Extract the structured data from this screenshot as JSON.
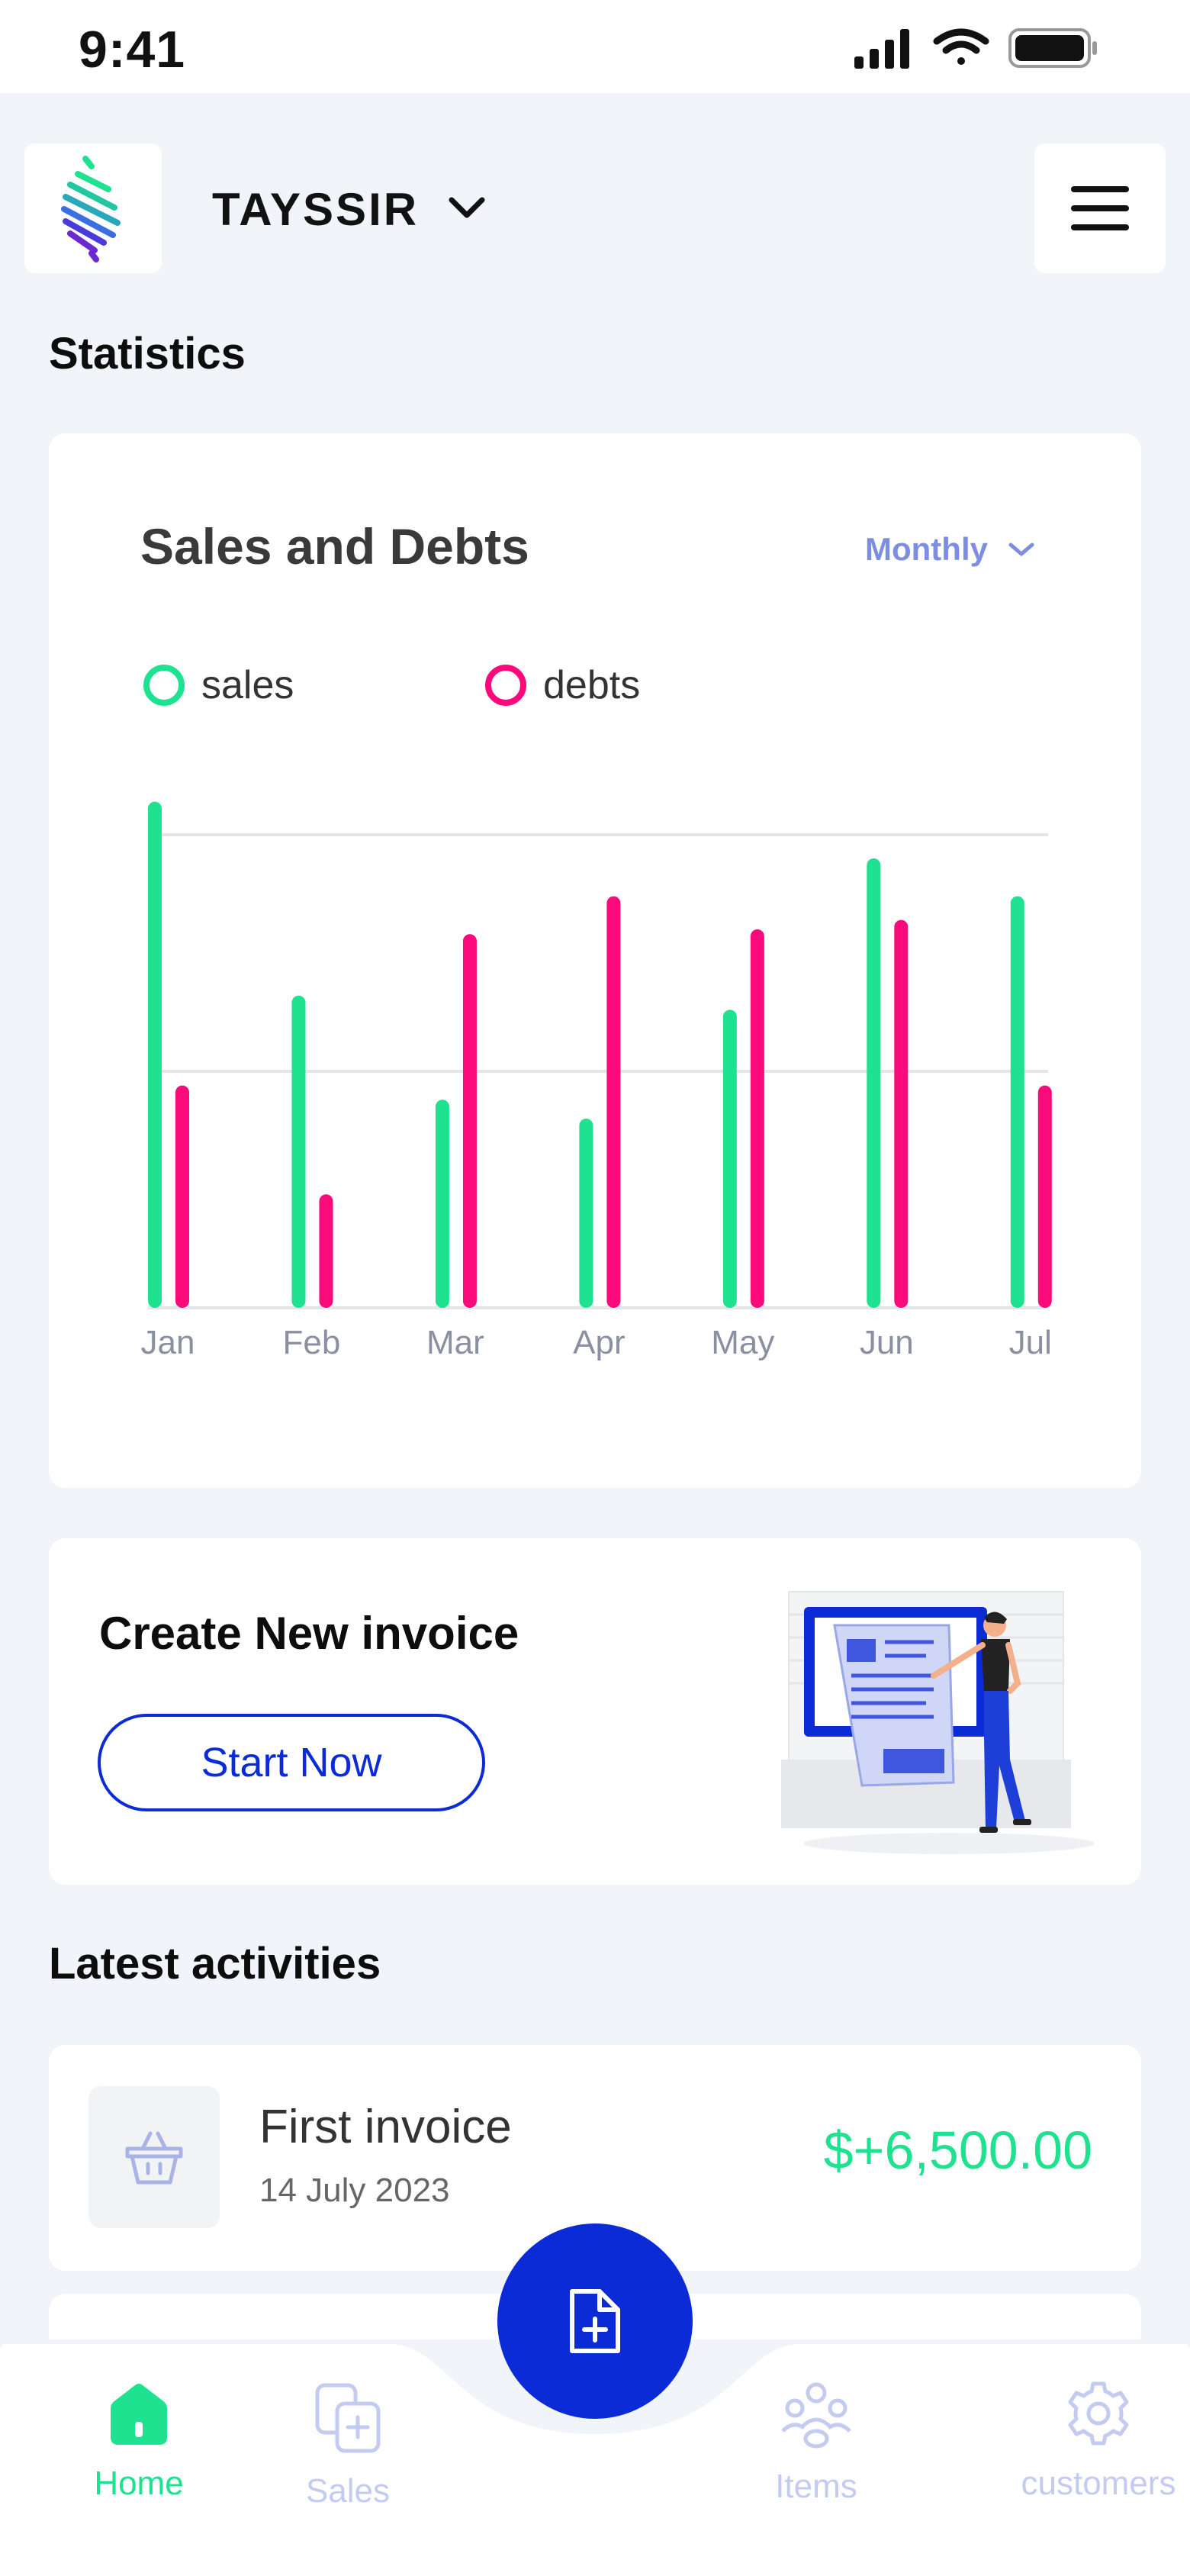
{
  "status_bar": {
    "time": "9:41"
  },
  "header": {
    "brand": "TAYSSIR"
  },
  "statistics": {
    "title": "Statistics"
  },
  "chart_card": {
    "title": "Sales and Debts",
    "period": "Monthly"
  },
  "chart_data": {
    "type": "bar",
    "categories": [
      "Jan",
      "Feb",
      "Mar",
      "Apr",
      "May",
      "Jun",
      "Jul"
    ],
    "series": [
      {
        "name": "sales",
        "color": "#1ee28f",
        "values": [
          1.07,
          0.66,
          0.44,
          0.4,
          0.63,
          0.95,
          0.87
        ]
      },
      {
        "name": "debts",
        "color": "#fa0a7a",
        "values": [
          0.47,
          0.24,
          0.79,
          0.87,
          0.8,
          0.82,
          0.47
        ]
      }
    ],
    "ylim": [
      0,
      1.1
    ],
    "gridlines": [
      0.5,
      1.0
    ],
    "legend": "top-left"
  },
  "invoice_card": {
    "title": "Create New invoice",
    "button_label": "Start Now"
  },
  "latest": {
    "title": "Latest activities",
    "items": [
      {
        "title": "First invoice",
        "date": "14 July 2023",
        "amount": "$+6,500.00"
      }
    ]
  },
  "nav": {
    "items": [
      {
        "label": "Home",
        "icon": "home-icon",
        "active": true
      },
      {
        "label": "Sales",
        "icon": "sales-icon",
        "active": false
      },
      {
        "label": "Items",
        "icon": "items-icon",
        "active": false
      },
      {
        "label": "customers",
        "icon": "gear-icon",
        "active": false
      }
    ],
    "fab_icon": "new-document-icon"
  },
  "colors": {
    "accent": "#0a2bd6",
    "sales": "#1ee28f",
    "debts": "#fa0a7a",
    "muted_nav": "#c4cbf0"
  }
}
